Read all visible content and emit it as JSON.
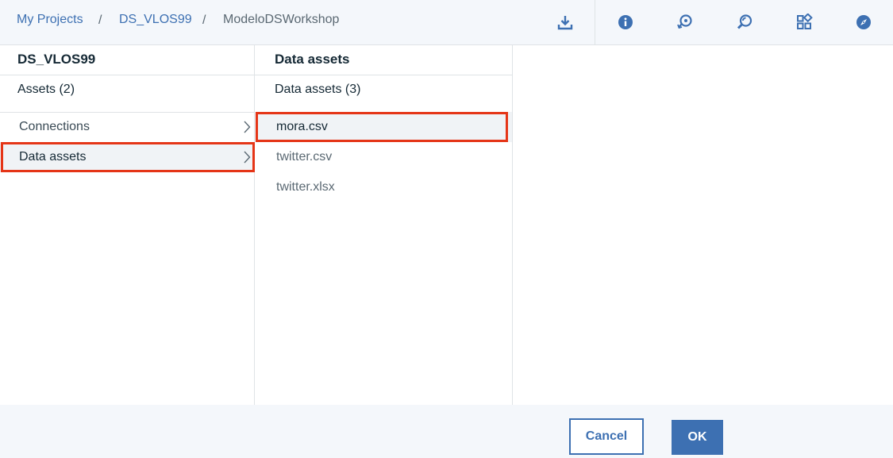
{
  "breadcrumb": {
    "items": [
      "My Projects",
      "DS_VLOS99",
      "ModeloDSWorkshop"
    ],
    "separator": "/"
  },
  "toolbar": {
    "icons": [
      "download-icon",
      "info-icon",
      "history-icon",
      "search-icon",
      "grid-icon",
      "compass-icon"
    ]
  },
  "columns": {
    "project": {
      "title": "DS_VLOS99",
      "subtitle": "Assets (2)",
      "items": [
        {
          "label": "Connections",
          "selected": false
        },
        {
          "label": "Data assets",
          "selected": true
        }
      ]
    },
    "assets": {
      "title": "Data assets",
      "subtitle": "Data assets (3)",
      "items": [
        {
          "label": "mora.csv",
          "selected": true
        },
        {
          "label": "twitter.csv",
          "selected": false
        },
        {
          "label": "twitter.xlsx",
          "selected": false
        }
      ]
    }
  },
  "footer": {
    "cancel_label": "Cancel",
    "ok_label": "OK"
  },
  "colors": {
    "accent": "#3d70b2",
    "highlight": "#e53517",
    "panel_bg": "#f4f7fb"
  }
}
